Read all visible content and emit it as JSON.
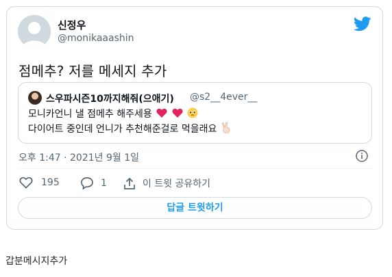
{
  "tweet": {
    "author_name": "신정우",
    "author_handle": "@monikaaashin",
    "text": "점메추? 저를 메세지 추가",
    "timestamp": "오후 1:47 · 2021년 9월 1일",
    "brand_color": "#1d9bf0",
    "quoted": {
      "author_name": "스우파시즌10까지해줘(으애기)",
      "author_handle": "@s2__4ever__",
      "line1": "모니카언니 낼 점메추 해주세용",
      "line2": "다이어트 중인데 언니가 추천해준걸로 먹을래요",
      "line1_emojis": [
        "heart-icon",
        "heart-icon",
        "pleading-face-icon"
      ],
      "line2_emoji": "victory-hand-icon"
    },
    "actions": {
      "like_count": "195",
      "reply_count": "1",
      "share_label": "이 트윗 공유하기"
    },
    "reply_button_label": "답글 트윗하기"
  },
  "footer": {
    "caption": "갑분메시지추가"
  }
}
